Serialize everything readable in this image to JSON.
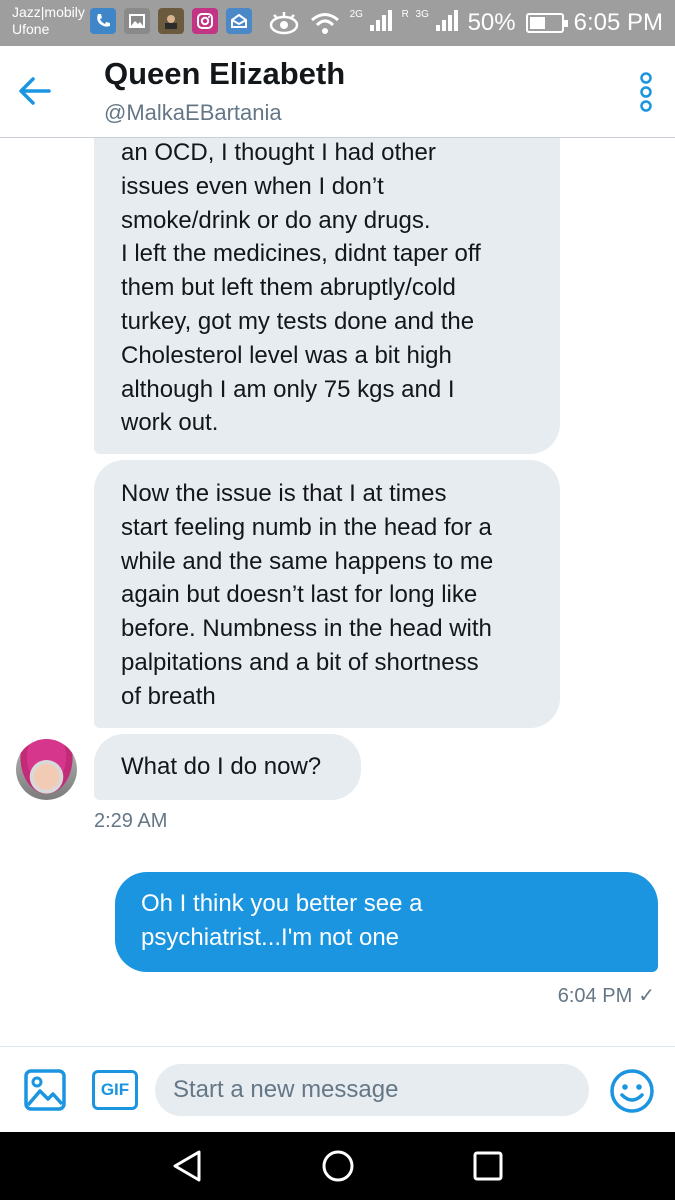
{
  "status_bar": {
    "carrier_primary": "Jazz|mobily",
    "carrier_secondary": "Ufone",
    "net_2g": "2G",
    "net_roaming": "R",
    "net_3g": "3G",
    "battery": "50%",
    "time": "6:05 PM",
    "app_icons": [
      "phone-app-icon",
      "gallery-app-icon",
      "photo-app-icon",
      "instagram-icon",
      "mail-app-icon"
    ]
  },
  "header": {
    "back_icon": "back-arrow-icon",
    "name": "Queen Elizabeth",
    "handle": "@MalkaEBartania",
    "menu_icon": "more-options-icon"
  },
  "messages": [
    {
      "direction": "received",
      "lines": [
        "an OCD, I thought I had other",
        "issues even when I don’t",
        "smoke/drink or do any drugs.",
        "I left the medicines, didnt taper off",
        "them but left them abruptly/cold",
        "turkey, got my tests done and the",
        "Cholesterol level was a bit high",
        "although I am only 75 kgs and I",
        "work out."
      ]
    },
    {
      "direction": "received",
      "lines": [
        "Now the issue is that I at times",
        "start feeling numb in the head for a",
        "while and the same happens to me",
        "again but doesn’t last for long like",
        "before. Numbness in the head with",
        "palpitations and a bit of shortness",
        "of breath"
      ]
    },
    {
      "direction": "received",
      "lines": [
        "What do I do now?"
      ]
    },
    {
      "direction": "sent",
      "lines": [
        "Oh I think you better see a",
        "psychiatrist...I'm not one"
      ]
    }
  ],
  "timestamps": {
    "received": "2:29 AM",
    "sent": "6:04 PM",
    "sent_status": "✓"
  },
  "composer": {
    "placeholder": "Start a new message",
    "gif_label": "GIF",
    "image_icon": "image-icon",
    "emoji_icon": "emoji-icon"
  },
  "nav": {
    "back_icon": "nav-back-icon",
    "home_icon": "nav-home-icon",
    "recents_icon": "nav-recents-icon"
  },
  "colors": {
    "accent": "#1b95e0",
    "received_bubble": "#e6ecf0",
    "secondary_text": "#657786",
    "status_bar": "#9e9e9e"
  }
}
